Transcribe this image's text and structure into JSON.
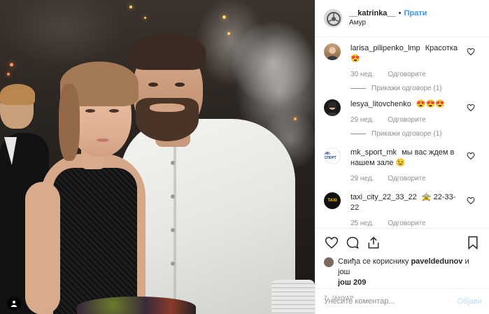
{
  "post": {
    "username": "__katrinka__",
    "separator": "•",
    "follow_label": "Прати",
    "location": "Амур"
  },
  "comments": [
    {
      "username": "larisa_pilipenko_lmp",
      "text": "Красотка😍",
      "age": "30 нед.",
      "reply_label": "Одговорите",
      "view_replies": "Прикажи одговоре (1)",
      "avatar": "woman-portrait"
    },
    {
      "username": "lesya_litovchenko",
      "text": "😍😍😍",
      "age": "29 нед.",
      "reply_label": "Одговорите",
      "view_replies": "Прикажи одговоре (1)",
      "avatar": "dark-portrait"
    },
    {
      "username": "mk_sport_mk",
      "text": "мы вас ждем в нашем зале 😉",
      "age": "29 нед.",
      "reply_label": "Одговорите",
      "view_replies": "",
      "avatar": "mk-sport-logo"
    },
    {
      "username": "taxi_city_22_33_22",
      "text": "🚖 22-33-22",
      "age": "25 нед.",
      "reply_label": "Одговорите",
      "view_replies": "",
      "avatar": "taxi-logo"
    }
  ],
  "avatar_labels": {
    "mk_sport": "MK-СПОРТ",
    "taxi": "TAXI"
  },
  "actions": {
    "like_icon": "heart-outline-icon",
    "comment_icon": "speech-bubble-icon",
    "share_icon": "share-upload-icon",
    "save_icon": "bookmark-icon"
  },
  "likes": {
    "prefix": "Свиђа се кориснику ",
    "user": "paveldedunov",
    "suffix": " и још ",
    "count_prefix": "још ",
    "count": "209"
  },
  "date": "7. ЈАНУАР",
  "add_comment": {
    "placeholder": "Унесите коментар...",
    "post_label": "Објави"
  },
  "colors": {
    "accent": "#3897f0",
    "post_disabled": "#b2dffc",
    "muted": "#8e8e8e"
  }
}
